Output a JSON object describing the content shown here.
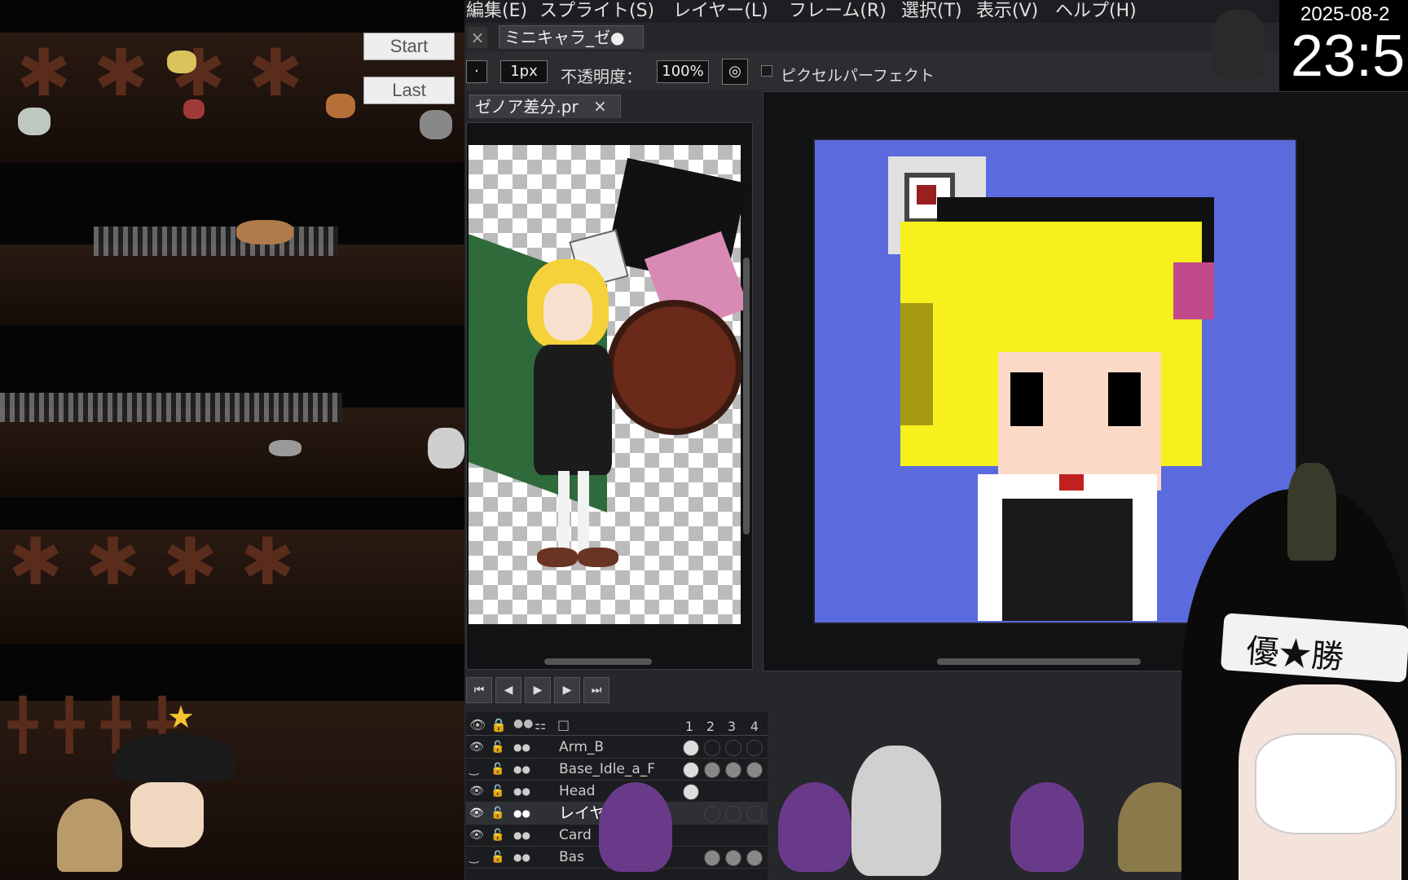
{
  "game": {
    "start_label": "Start",
    "last_label": "Last"
  },
  "menubar": {
    "items": [
      "編集(E)",
      "スプライト(S)",
      "レイヤー(L)",
      "フレーム(R)",
      "選択(T)",
      "表示(V)",
      "ヘルプ(H)"
    ]
  },
  "tabs": {
    "document_tab": "ミニキャラ_ゼ●",
    "reference_tab": "ゼノア差分.pr"
  },
  "toolbar": {
    "brush_size": "1px",
    "opacity_label": "不透明度：",
    "opacity_value": "100%",
    "pixel_perfect_label": "ピクセルパーフェクト"
  },
  "playback": {
    "icons": [
      "first-frame-icon",
      "prev-frame-icon",
      "play-icon",
      "next-frame-icon",
      "last-frame-icon"
    ]
  },
  "timeline": {
    "frame_numbers": [
      "1",
      "2",
      "3",
      "4"
    ],
    "layers": [
      {
        "name": "Arm_B"
      },
      {
        "name": "Base_Idle_a_F"
      },
      {
        "name": "Head"
      },
      {
        "name": "レイヤ"
      },
      {
        "name": "Card"
      },
      {
        "name": "Bas"
      }
    ]
  },
  "overlay": {
    "date": "2025-08-2",
    "time": "23:5",
    "headband_text": "優★勝"
  },
  "colors": {
    "canvas_bg": "#5b6bde",
    "hair": "#f7f01c",
    "editor_bg": "#26272b"
  }
}
